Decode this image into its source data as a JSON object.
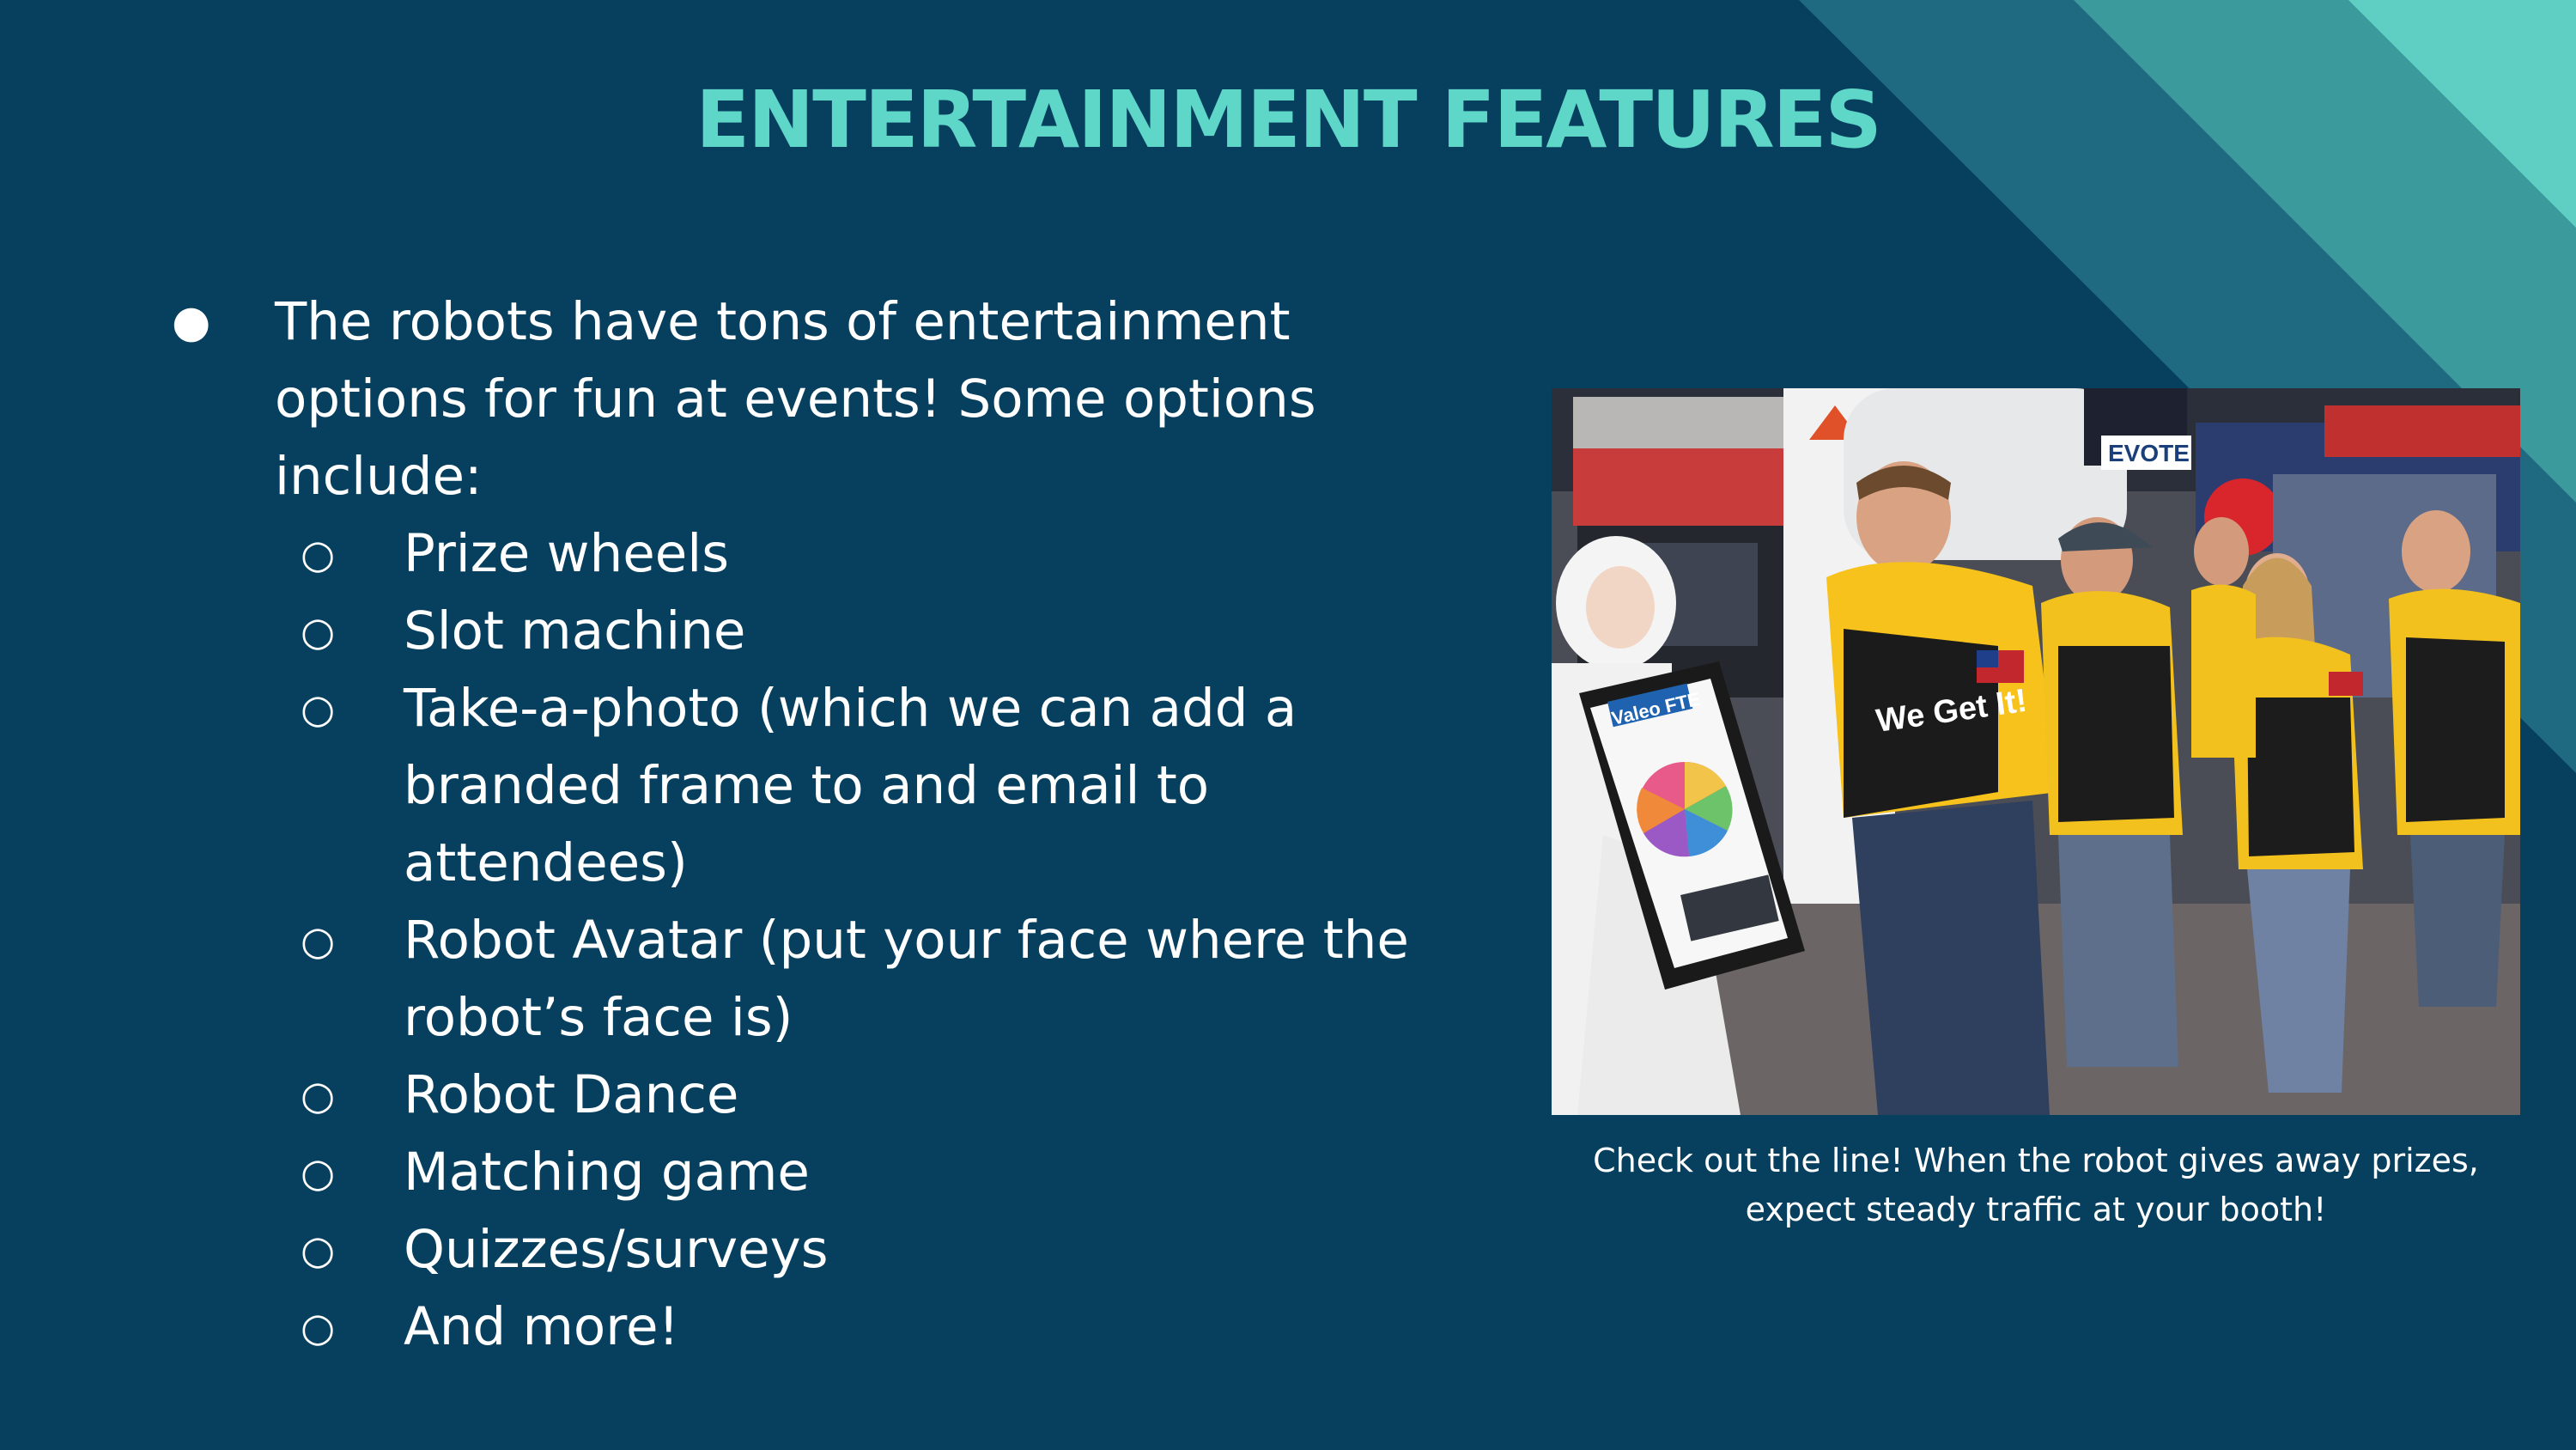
{
  "slide": {
    "title": "ENTERTAINMENT FEATURES",
    "intro": "The robots have tons of entertainment options for fun at events! Some options include:",
    "options": [
      "Prize wheels",
      "Slot machine",
      "Take-a-photo (which we can add a branded frame to and email to attendees)",
      "Robot Avatar (put your face where the robot’s face is)",
      "Robot Dance",
      "Matching game",
      "Quizzes/surveys",
      "And more!"
    ],
    "caption": "Check out the line! When the robot gives away prizes, expect steady traffic at your booth!",
    "photo_texts": {
      "screen_brand": "Valeo FTE",
      "booth_sign": "EVOTE",
      "shirt_text": "We Get It!"
    }
  },
  "colors": {
    "background": "#073f5e",
    "title": "#5ed6c8",
    "stripe_light": "#5fcfc3",
    "stripe_mid": "#3f9e9f",
    "stripe_dark": "#2a7484",
    "text": "#ffffff"
  }
}
